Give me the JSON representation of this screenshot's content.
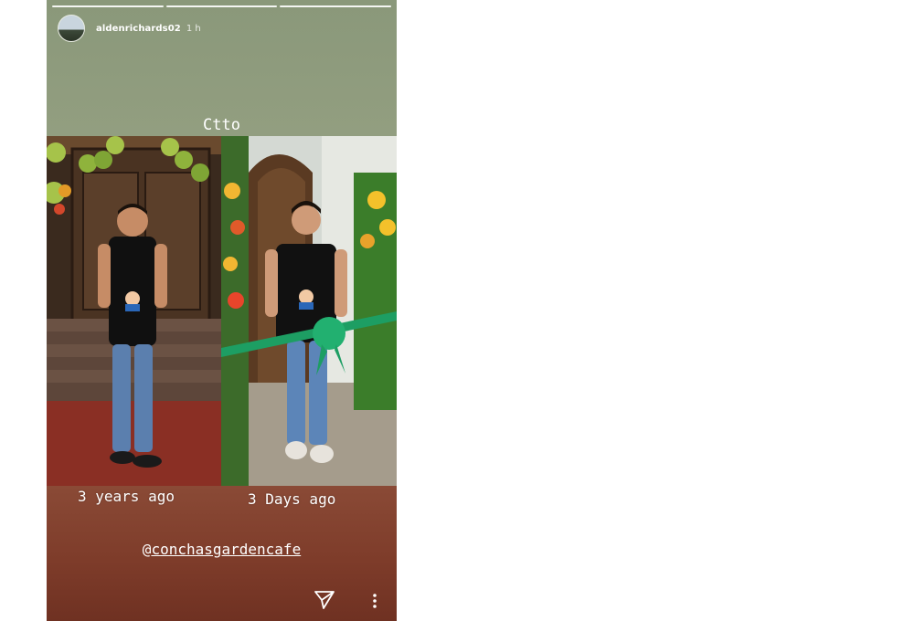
{
  "story": {
    "username": "aldenrichards02",
    "time": "1 h",
    "caption": "Ctto",
    "labels": {
      "left": "3 years ago",
      "right": "3 Days ago"
    },
    "mention": {
      "at": "@",
      "handle": "conchasgardencafe"
    }
  },
  "colors": {
    "top_bg": "#a1a98a",
    "bottom_bg": "#7e3c2a",
    "ribbon": "#1d9e63"
  },
  "icons": [
    "avatar",
    "send-icon",
    "more-options-icon"
  ]
}
